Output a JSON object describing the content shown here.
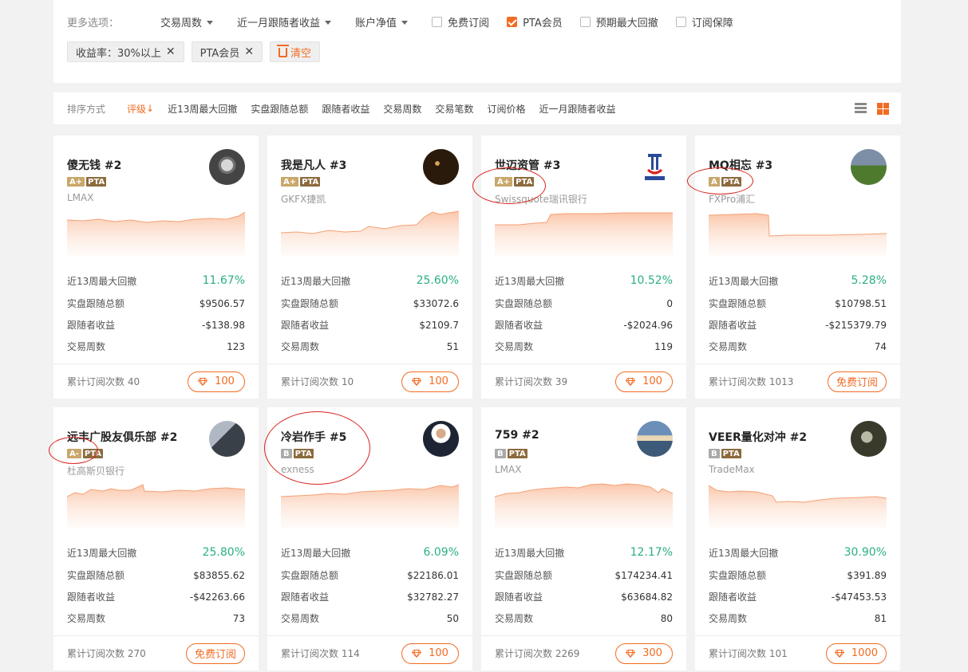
{
  "filters": {
    "label": "更多选项：",
    "dropdowns": [
      "交易周数",
      "近一月跟随者收益",
      "账户净值"
    ],
    "checkboxes": [
      {
        "label": "免费订阅",
        "checked": false
      },
      {
        "label": "PTA会员",
        "checked": true
      },
      {
        "label": "预期最大回撤",
        "checked": false
      },
      {
        "label": "订阅保障",
        "checked": false
      }
    ],
    "chips": [
      "收益率：30%以上",
      "PTA会员"
    ],
    "clear_label": "清空"
  },
  "sort": {
    "label": "排序方式",
    "active": "评级",
    "arrow": "↓",
    "options": [
      "近13周最大回撤",
      "实盘跟随总额",
      "跟随者收益",
      "交易周数",
      "交易笔数",
      "订阅价格",
      "近一月跟随者收益"
    ]
  },
  "stat_labels": [
    "近13周最大回撤",
    "实盘跟随总额",
    "跟随者收益",
    "交易周数"
  ],
  "subs_prefix": "累计订阅次数",
  "colors": {
    "accent": "#f26b23",
    "green": "#2bb07f",
    "rank_gold": "#c9a76b",
    "rank_gray": "#a9a9a9",
    "pta_brown": "#8c6a3d",
    "annotation_red": "#d9231d"
  },
  "cards": [
    {
      "name": "傻无钱 #2",
      "rank": "A+",
      "pta": "PTA",
      "broker": "LMAX",
      "drawdown": "11.67%",
      "total": "$9506.57",
      "profit": "-$138.98",
      "weeks": "123",
      "subs": "40",
      "price": "100",
      "free": false,
      "avatar": "avatar-bridge"
    },
    {
      "name": "我是凡人 #3",
      "rank": "A+",
      "pta": "PTA",
      "broker": "GKFX捷凯",
      "drawdown": "25.60%",
      "total": "$33072.6",
      "profit": "$2109.7",
      "weeks": "51",
      "subs": "10",
      "price": "100",
      "free": false,
      "avatar": "avatar-candles"
    },
    {
      "name": "世迈资管 #3",
      "rank": "A+",
      "pta": "PTA",
      "broker": "Swissquote瑞讯银行",
      "drawdown": "10.52%",
      "total": "0",
      "profit": "-$2024.96",
      "weeks": "119",
      "subs": "39",
      "price": "100",
      "free": false,
      "avatar": "avatar-logo"
    },
    {
      "name": "MQ相忘 #3",
      "rank": "A",
      "pta": "PTA",
      "broker": "FXPro浦汇",
      "drawdown": "5.28%",
      "total": "$10798.51",
      "profit": "-$215379.79",
      "weeks": "74",
      "subs": "1013",
      "price": "免费订阅",
      "free": true,
      "avatar": "avatar-landscape"
    },
    {
      "name": "远丰广股友俱乐部 #2",
      "rank": "A-",
      "pta": "PTA",
      "broker": "杜高斯贝银行",
      "drawdown": "25.80%",
      "total": "$83855.62",
      "profit": "-$42263.66",
      "weeks": "73",
      "subs": "270",
      "price": "免费订阅",
      "free": true,
      "avatar": "avatar-room"
    },
    {
      "name": "冷岩作手 #5",
      "rank": "B",
      "pta": "PTA",
      "broker": "exness",
      "drawdown": "6.09%",
      "total": "$22186.01",
      "profit": "$32782.27",
      "weeks": "50",
      "subs": "114",
      "price": "100",
      "free": false,
      "avatar": "avatar-person"
    },
    {
      "name": "759 #2",
      "rank": "B",
      "pta": "PTA",
      "broker": "LMAX",
      "drawdown": "12.17%",
      "total": "$174234.41",
      "profit": "$63684.82",
      "weeks": "80",
      "subs": "2269",
      "price": "300",
      "free": false,
      "avatar": "avatar-sunset"
    },
    {
      "name": "VEER量化对冲 #2",
      "rank": "B",
      "pta": "PTA",
      "broker": "TradeMax",
      "drawdown": "30.90%",
      "total": "$391.89",
      "profit": "-$47453.53",
      "weeks": "81",
      "subs": "101",
      "price": "1000",
      "free": false,
      "avatar": "avatar-forest"
    }
  ]
}
